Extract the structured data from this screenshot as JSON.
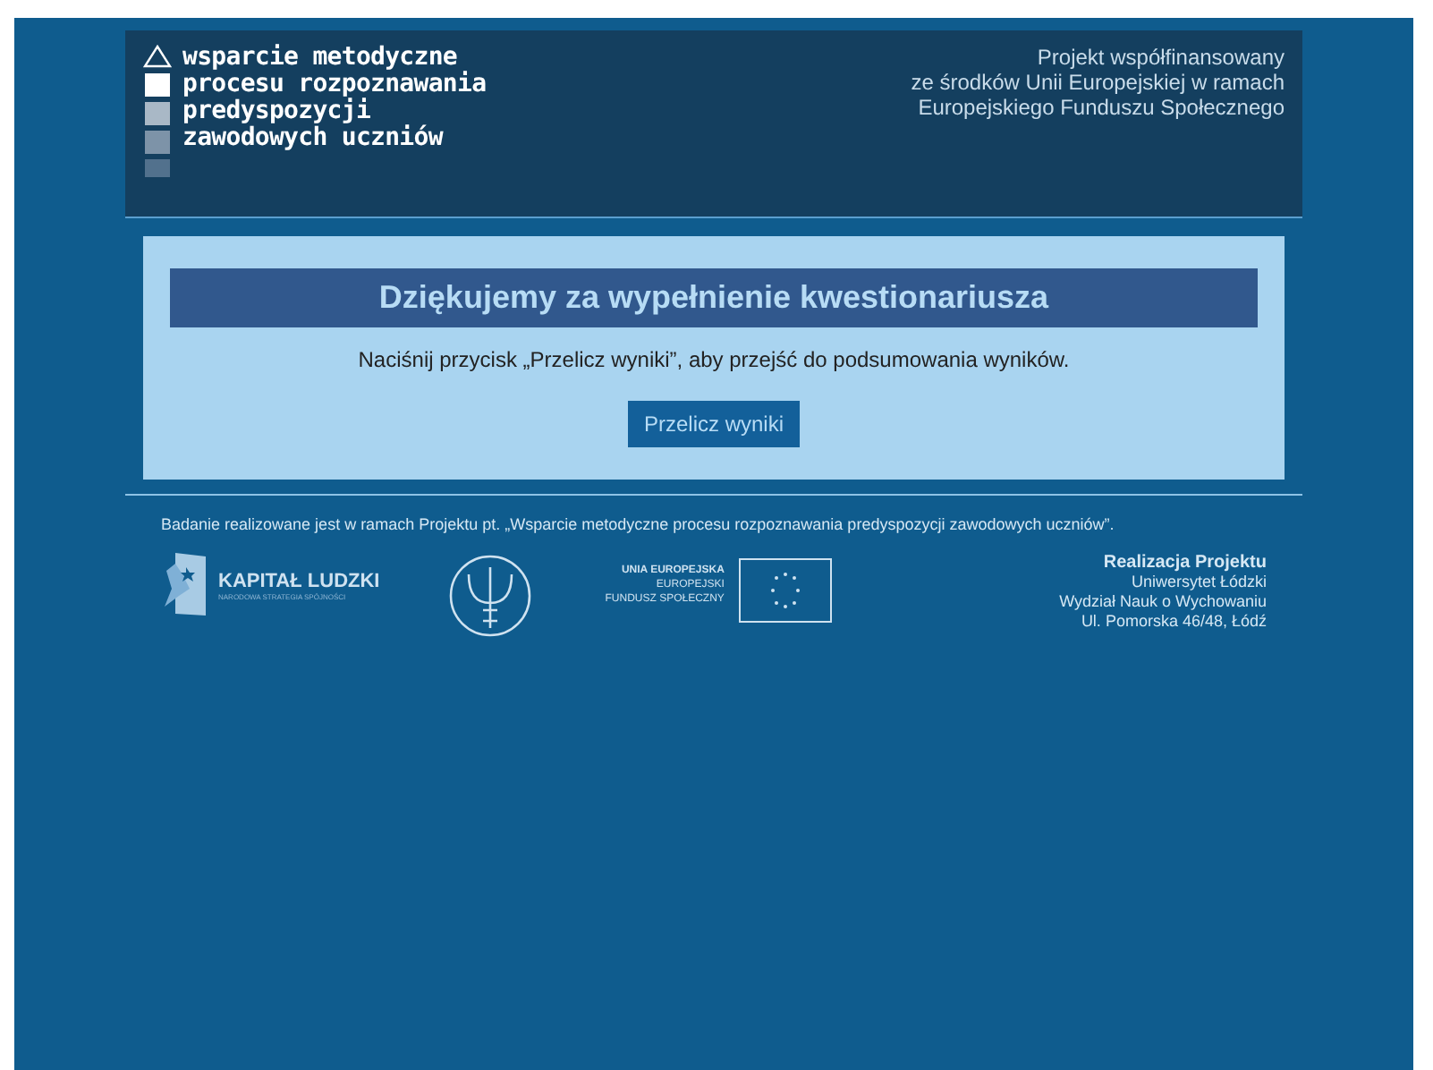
{
  "header": {
    "logo_lines": [
      "wsparcie metodyczne",
      "procesu rozpoznawania",
      "predyspozycji",
      "zawodowych uczniów"
    ],
    "cofinancing": [
      "Projekt współfinansowany",
      "ze środków Unii Europejskiej w ramach",
      "Europejskiego Funduszu Społecznego"
    ]
  },
  "main": {
    "title": "Dziękujemy za wypełnienie kwestionariusza",
    "instruction": "Naciśnij przycisk „Przelicz wyniki”, aby przejść do podsumowania wyników.",
    "button": "Przelicz wyniki"
  },
  "footer": {
    "note": "Badanie realizowane jest w ramach Projektu pt. „Wsparcie metodyczne procesu rozpoznawania predyspozycji zawodowych uczniów”.",
    "kapital_ludzki": {
      "name": "KAPITAŁ LUDZKI",
      "subtitle": "NARODOWA STRATEGIA SPÓJNOŚCI"
    },
    "eu": [
      "UNIA EUROPEJSKA",
      "EUROPEJSKI",
      "FUNDUSZ SPOŁECZNY"
    ],
    "realization": {
      "title": "Realizacja Projektu",
      "lines": [
        "Uniwersytet Łódzki",
        "Wydział Nauk o Wychowaniu",
        "Ul. Pomorska 46/48, Łódź"
      ]
    }
  }
}
